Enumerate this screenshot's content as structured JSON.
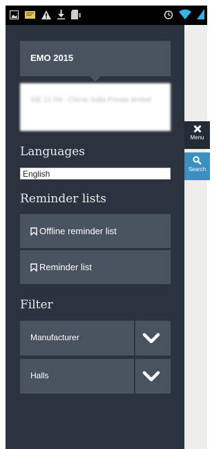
{
  "status_bar": {
    "icons": [
      "image-icon",
      "message-icon",
      "warning-icon",
      "download-icon",
      "sd-card-icon",
      "alarm-icon",
      "wifi-icon",
      "signal-icon"
    ]
  },
  "side_tabs": {
    "menu_label": "Menu",
    "search_label": "Search"
  },
  "event": {
    "title": "EMO 2015",
    "card_text": "SIE 12 FN - Chinar India Private limited"
  },
  "languages": {
    "heading": "Languages",
    "selected": "English"
  },
  "reminder_lists": {
    "heading": "Reminder lists",
    "items": [
      {
        "label": "Offline reminder list"
      },
      {
        "label": "Reminder list"
      }
    ]
  },
  "filter": {
    "heading": "Filter",
    "items": [
      {
        "label": "Manufacturer"
      },
      {
        "label": "Halls"
      }
    ]
  },
  "colors": {
    "drawer_bg": "#2a333e",
    "button_bg": "#49525f",
    "search_tab": "#3b8ec0",
    "content_bg": "#eeeeec"
  }
}
